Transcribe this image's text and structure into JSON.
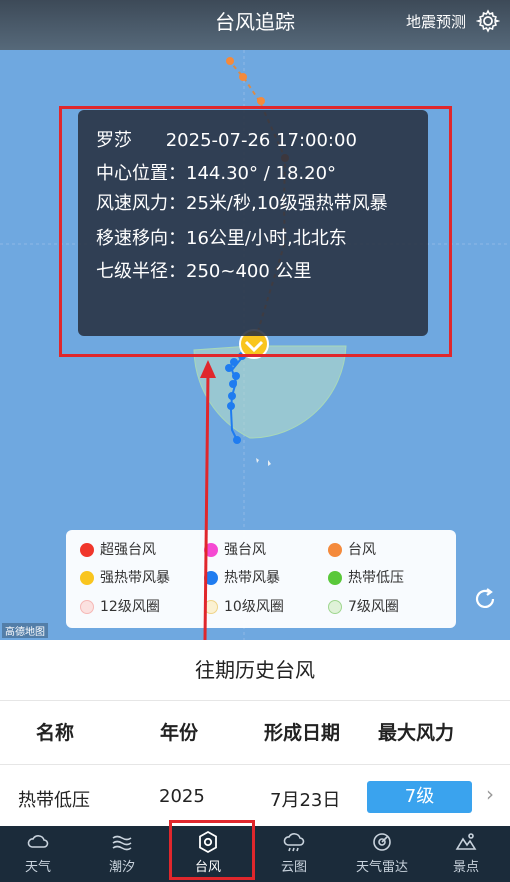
{
  "header": {
    "title": "台风追踪",
    "quake_link": "地震预测",
    "settings_icon": "gear-icon"
  },
  "popup": {
    "name": "罗莎",
    "time": "2025-07-26 17:00:00",
    "center_label": "中心位置：",
    "center_value": "144.30° / 18.20°",
    "wind_label": "风速风力：",
    "wind_value": "25米/秒,10级强热带风暴",
    "move_label": "移速移向：",
    "move_value": "16公里/小时,北北东",
    "radius_label": "七级半径：",
    "radius_value": "250~400 公里"
  },
  "map": {
    "logo": "高德地图",
    "refresh_icon": "refresh-icon"
  },
  "legend": {
    "items": [
      {
        "label": "超强台风",
        "color": "#f0362b",
        "style": "solid"
      },
      {
        "label": "强台风",
        "color": "#f549d2",
        "style": "solid"
      },
      {
        "label": "台风",
        "color": "#f48a3c",
        "style": "solid"
      },
      {
        "label": "强热带风暴",
        "color": "#f9c51f",
        "style": "solid"
      },
      {
        "label": "热带风暴",
        "color": "#1f7cf0",
        "style": "solid"
      },
      {
        "label": "热带低压",
        "color": "#5ac83a",
        "style": "solid"
      },
      {
        "label": "12级风圈",
        "color": "#f6b8b6",
        "style": "ring"
      },
      {
        "label": "10级风圈",
        "color": "#f6e2a8",
        "style": "ring"
      },
      {
        "label": "7级风圈",
        "color": "#bfe7b5",
        "style": "ring"
      }
    ]
  },
  "history": {
    "title": "往期历史台风",
    "headers": [
      "名称",
      "年份",
      "形成日期",
      "最大风力"
    ],
    "row": {
      "name": "热带低压",
      "year": "2025",
      "date": "7月23日",
      "level": "7级"
    }
  },
  "nav": {
    "tabs": [
      {
        "label": "天气",
        "icon": "weather-icon"
      },
      {
        "label": "潮汐",
        "icon": "tide-icon"
      },
      {
        "label": "台风",
        "icon": "typhoon-icon"
      },
      {
        "label": "云图",
        "icon": "cloud-map-icon"
      },
      {
        "label": "天气雷达",
        "icon": "radar-icon"
      },
      {
        "label": "景点",
        "icon": "scenic-icon"
      }
    ]
  },
  "colors": {
    "accent_red": "#e0272c",
    "badge_blue": "#3aa3ee",
    "nav_bg": "#1b2b3a",
    "map_sea": "#6fa8e0"
  }
}
